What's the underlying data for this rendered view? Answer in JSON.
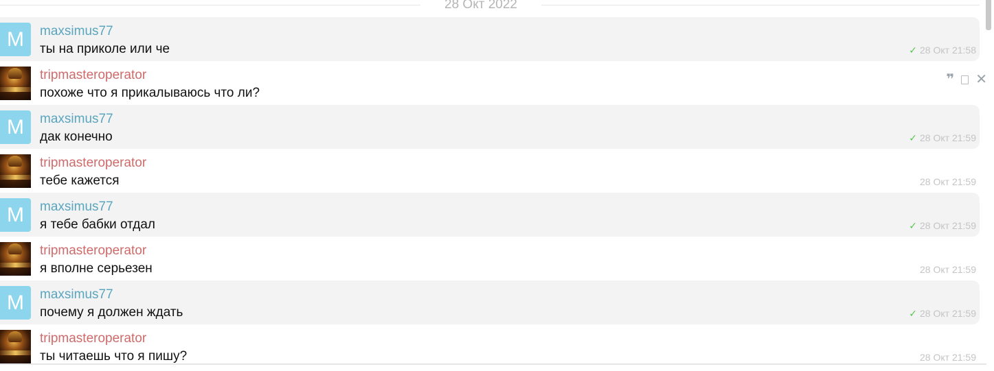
{
  "date_separator": "28 Окт 2022",
  "messages": [
    {
      "sender": "maxsimus77",
      "avatar_letter": "M",
      "text": "ты на приколе или че",
      "time": "28 Окт 21:58",
      "read": "✓"
    },
    {
      "sender": "tripmasteroperator",
      "text": "похоже что я прикалываюсь что ли?",
      "time": ""
    },
    {
      "sender": "maxsimus77",
      "avatar_letter": "M",
      "text": "дак конечно",
      "time": "28 Окт 21:59",
      "read": "✓"
    },
    {
      "sender": "tripmasteroperator",
      "text": "тебе кажется",
      "time": "28 Окт 21:59"
    },
    {
      "sender": "maxsimus77",
      "avatar_letter": "M",
      "text": "я тебе бабки отдал",
      "time": "28 Окт 21:59",
      "read": "✓"
    },
    {
      "sender": "tripmasteroperator",
      "text": "я вполне серьезен",
      "time": "28 Окт 21:59"
    },
    {
      "sender": "maxsimus77",
      "avatar_letter": "M",
      "text": "почему я должен ждать",
      "time": "28 Окт 21:59",
      "read": "✓"
    },
    {
      "sender": "tripmasteroperator",
      "text": "ты читаешь что я пишу?",
      "time": "28 Окт 21:59"
    }
  ],
  "hover_actions": {
    "quote_icon": "quote-icon",
    "copy_icon": "copy-icon",
    "close_icon": "close-icon",
    "quote_glyph": "❞",
    "close_glyph": "✕"
  },
  "colors": {
    "sender_blue": "#5aa5c0",
    "sender_red": "#cf6a6a",
    "avatar_letter_bg": "#8dd5ed",
    "read_check": "#5cc35a",
    "shaded_row": "#f3f3f3"
  }
}
